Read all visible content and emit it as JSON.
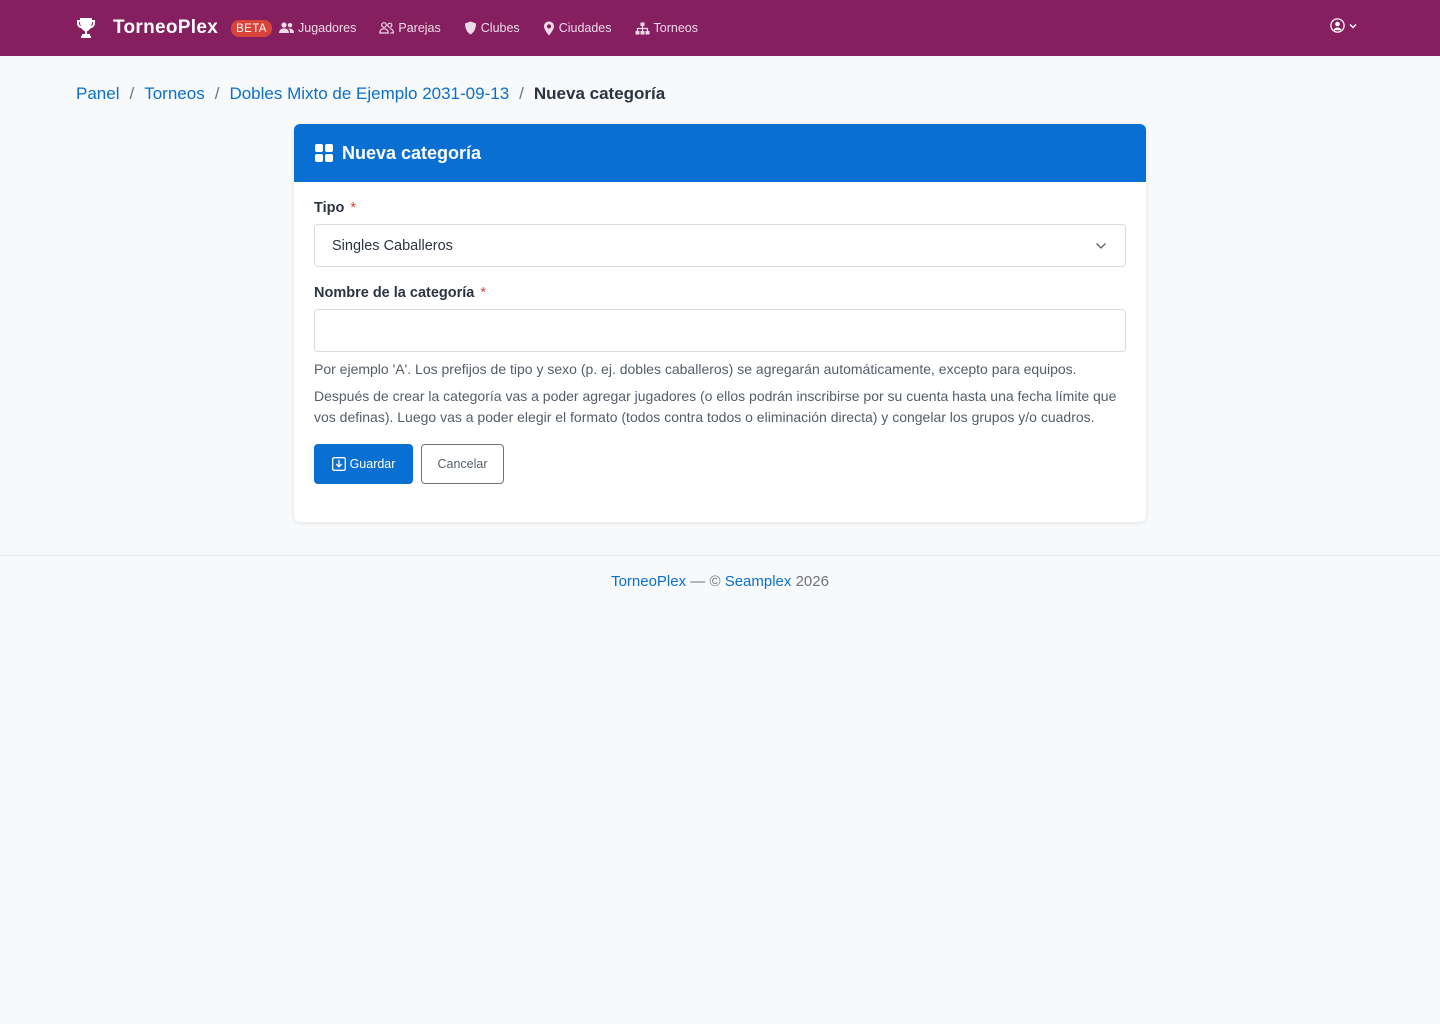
{
  "navbar": {
    "brand": "TorneoPlex",
    "badge": "BETA",
    "links": [
      {
        "label": "Jugadores",
        "icon": "users-icon"
      },
      {
        "label": "Parejas",
        "icon": "user-pair-icon"
      },
      {
        "label": "Clubes",
        "icon": "shield-icon"
      },
      {
        "label": "Ciudades",
        "icon": "map-pin-icon"
      },
      {
        "label": "Torneos",
        "icon": "sitemap-icon"
      }
    ],
    "colors": {
      "background": "#861f5f",
      "badge": "#d9443a"
    }
  },
  "breadcrumb": {
    "items": [
      "Panel",
      "Torneos",
      "Dobles Mixto de Ejemplo 2031-09-13"
    ],
    "current": "Nueva categoría",
    "separator": "/"
  },
  "card": {
    "title": "Nueva categoría",
    "header_color": "#0a6fd2",
    "fields": {
      "tipo": {
        "label": "Tipo",
        "required_mark": "*",
        "value": "Singles Caballeros"
      },
      "nombre": {
        "label": "Nombre de la categoría",
        "required_mark": "*",
        "value": "",
        "placeholder": ""
      }
    },
    "help_text": "Por ejemplo 'A'. Los prefijos de tipo y sexo (p. ej. dobles caballeros) se agregarán automáticamente, excepto para equipos.",
    "info_text": "Después de crear la categoría vas a poder agregar jugadores (o ellos podrán inscribirse por su cuenta hasta una fecha límite que vos definas). Luego vas a poder elegir el formato (todos contra todos o eliminación directa) y congelar los grupos y/o cuadros.",
    "buttons": {
      "save": "Guardar",
      "cancel": "Cancelar"
    }
  },
  "footer": {
    "site": "TorneoPlex",
    "separator": "— ©",
    "company": "Seamplex",
    "year": "2026"
  }
}
